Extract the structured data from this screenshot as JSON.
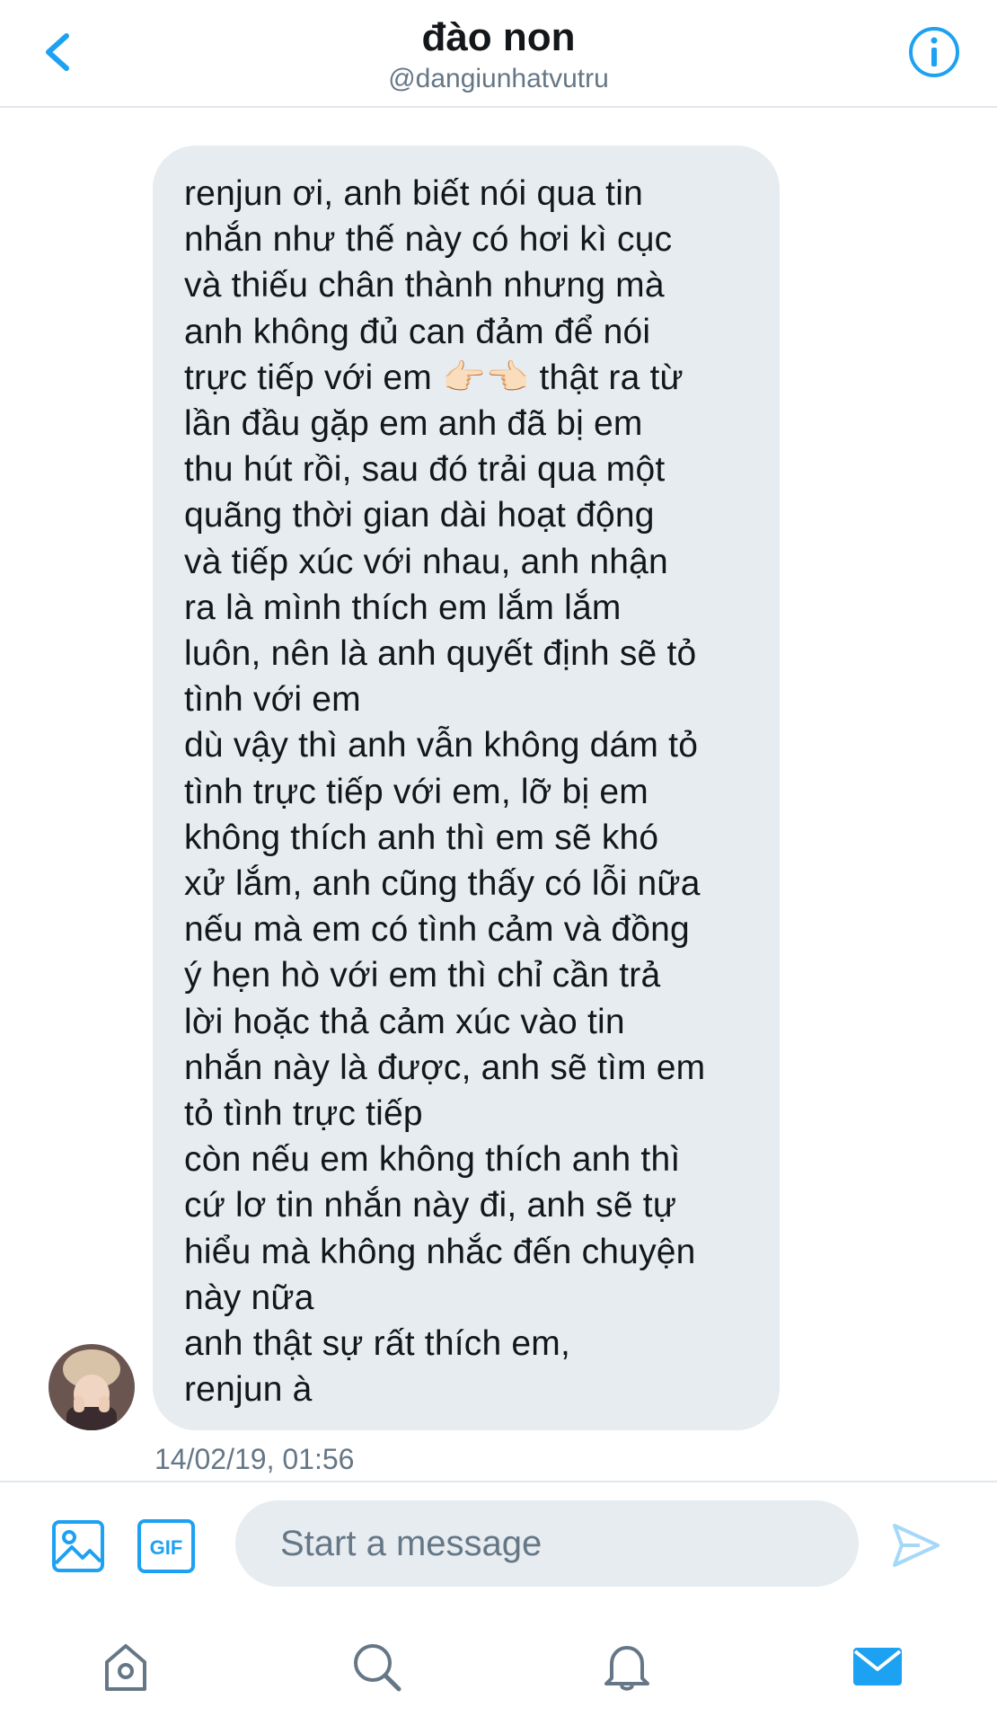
{
  "header": {
    "title": "đào non",
    "handle": "@dangiunhatvutru"
  },
  "message": {
    "text": "renjun ơi, anh biết nói qua tin\nnhắn như thế này có hơi kì cục\nvà thiếu chân thành nhưng mà\nanh không đủ can đảm để nói\ntrực tiếp với em 👉🏻👈🏻 thật ra từ\nlần đầu gặp em anh đã bị em\nthu hút rồi, sau đó trải qua một\nquãng thời gian dài hoạt động\nvà tiếp xúc với nhau, anh nhận\nra là mình thích em lắm lắm\nluôn, nên là anh quyết định sẽ tỏ\ntình với em\ndù vậy thì anh vẫn không dám tỏ\ntình trực tiếp với em, lỡ bị em\nkhông thích anh thì em sẽ khó\nxử lắm, anh cũng thấy có lỗi nữa\nnếu mà em có tình cảm và đồng\ný hẹn hò với em thì chỉ cần trả\nlời hoặc thả cảm xúc vào tin\nnhắn này là được, anh sẽ tìm em\ntỏ tình trực tiếp\ncòn nếu em không thích anh thì\ncứ lơ tin nhắn này đi, anh sẽ tự\nhiểu mà không nhắc đến chuyện\nnày nữa\nanh thật sự rất thích em,\nrenjun à",
    "timestamp": "14/02/19, 01:56"
  },
  "composer": {
    "placeholder": "Start a message",
    "gif_label": "GIF"
  },
  "icons": {
    "back": "chevron-left-icon",
    "info": "info-icon",
    "image": "image-icon",
    "gif": "gif-icon",
    "send": "send-icon",
    "home": "home-icon",
    "search": "search-icon",
    "notifications": "bell-icon",
    "messages": "mail-icon"
  },
  "colors": {
    "accent": "#1da1f2",
    "bubble": "#e6ecf0",
    "secondary_text": "#657786",
    "tab_icon": "#657786",
    "send_disabled": "#a5d8f8"
  }
}
